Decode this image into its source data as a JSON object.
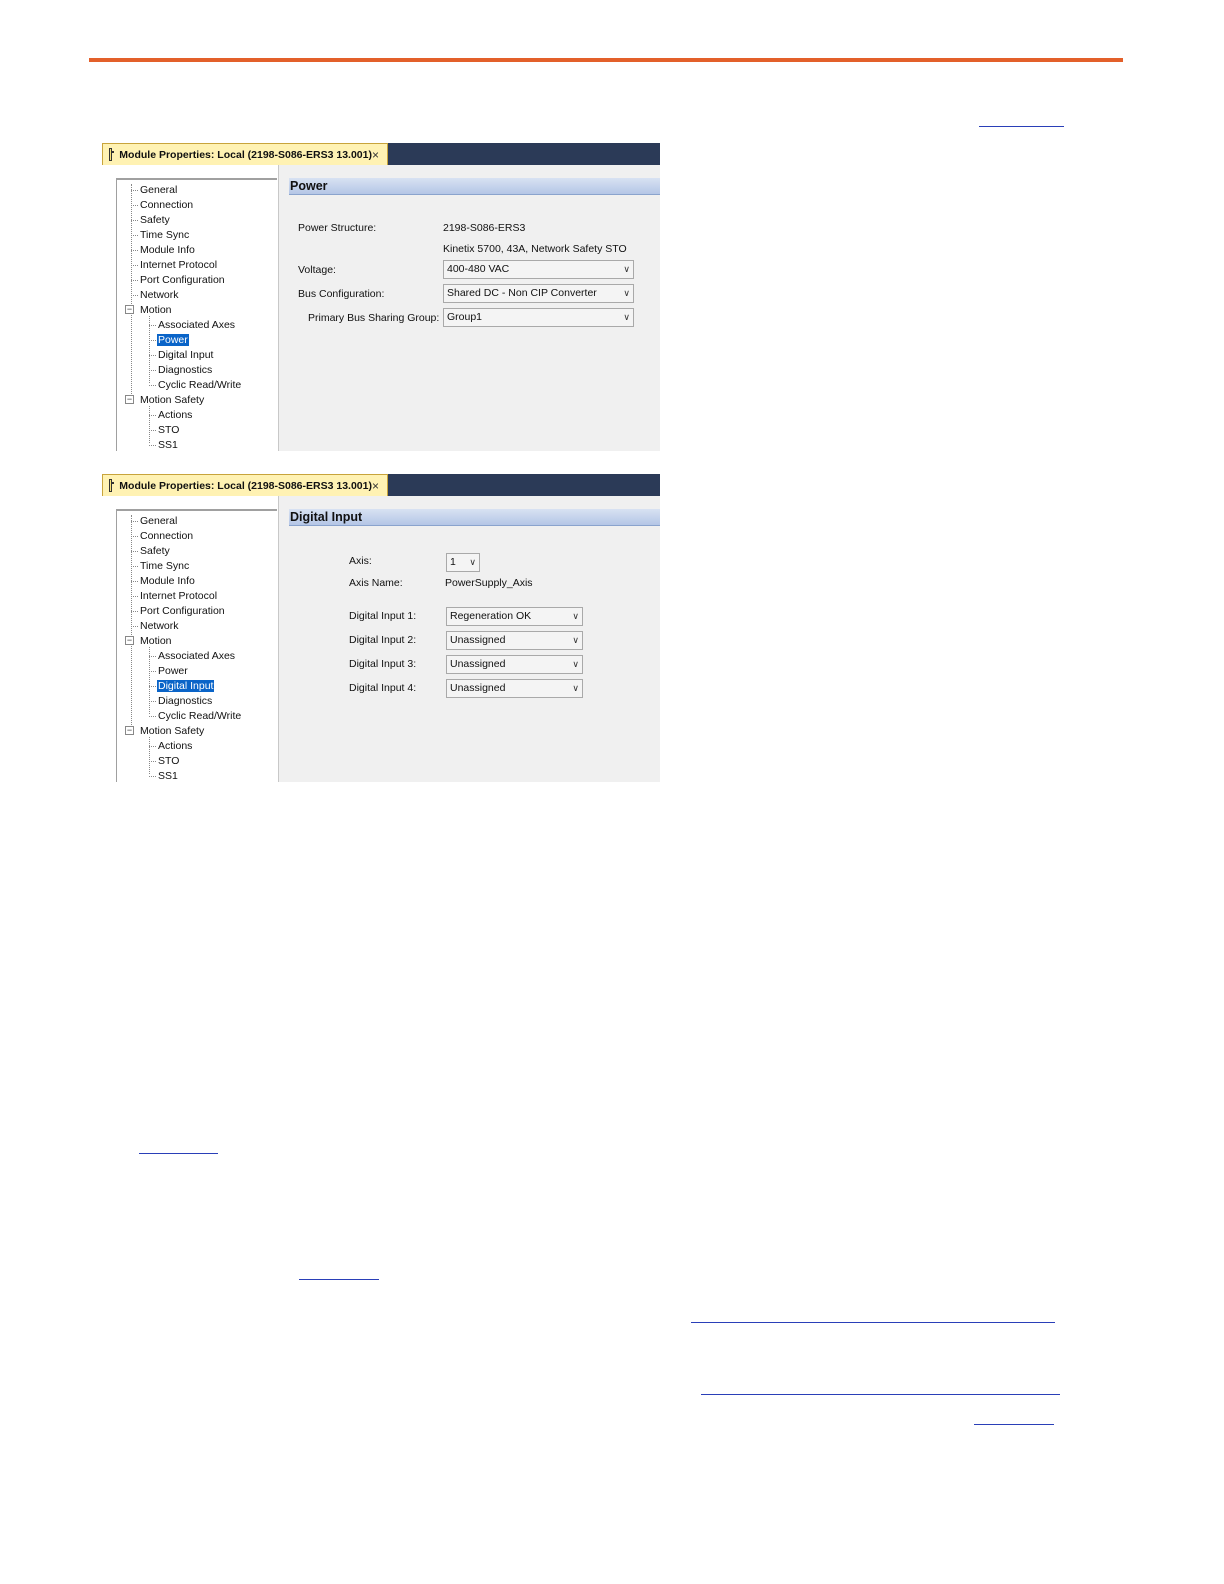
{
  "dialogs": [
    {
      "tab_title": "Module Properties: Local (2198-S086-ERS3 13.001)",
      "close_glyph": "×",
      "section": "Power",
      "selected_node": "Power",
      "tree": {
        "general": "General",
        "connection": "Connection",
        "safety": "Safety",
        "time_sync": "Time Sync",
        "module_info": "Module Info",
        "internet_protocol": "Internet Protocol",
        "port_configuration": "Port Configuration",
        "network": "Network",
        "motion": "Motion",
        "associated_axes": "Associated Axes",
        "power": "Power",
        "digital_input": "Digital Input",
        "diagnostics": "Diagnostics",
        "cyclic_read_write": "Cyclic Read/Write",
        "motion_safety": "Motion Safety",
        "actions": "Actions",
        "sto": "STO",
        "ss1": "SS1",
        "collapse_glyph": "−"
      },
      "fields": {
        "power_structure_label": "Power Structure:",
        "power_structure_value": "2198-S086-ERS3",
        "power_structure_desc": "Kinetix 5700, 43A, Network Safety STO",
        "voltage_label": "Voltage:",
        "voltage_value": "400-480 VAC",
        "bus_configuration_label": "Bus Configuration:",
        "bus_configuration_value": "Shared DC - Non CIP Converter",
        "bus_sharing_group_label": "Primary Bus Sharing Group:",
        "bus_sharing_group_value": "Group1"
      }
    },
    {
      "tab_title": "Module Properties: Local (2198-S086-ERS3 13.001)",
      "close_glyph": "×",
      "section": "Digital Input",
      "selected_node": "Digital Input",
      "tree": {
        "general": "General",
        "connection": "Connection",
        "safety": "Safety",
        "time_sync": "Time Sync",
        "module_info": "Module Info",
        "internet_protocol": "Internet Protocol",
        "port_configuration": "Port Configuration",
        "network": "Network",
        "motion": "Motion",
        "associated_axes": "Associated Axes",
        "power": "Power",
        "digital_input": "Digital Input",
        "diagnostics": "Diagnostics",
        "cyclic_read_write": "Cyclic Read/Write",
        "motion_safety": "Motion Safety",
        "actions": "Actions",
        "sto": "STO",
        "ss1": "SS1",
        "collapse_glyph": "−"
      },
      "fields": {
        "axis_label": "Axis:",
        "axis_value": "1",
        "axis_name_label": "Axis Name:",
        "axis_name_value": "PowerSupply_Axis",
        "di1_label": "Digital Input 1:",
        "di1_value": "Regeneration OK",
        "di2_label": "Digital Input 2:",
        "di2_value": "Unassigned",
        "di3_label": "Digital Input 3:",
        "di3_value": "Unassigned",
        "di4_label": "Digital Input 4:",
        "di4_value": "Unassigned"
      }
    }
  ],
  "icons": {
    "tab": "module-icon",
    "close": "close-icon",
    "dropdown": "chevron-down-icon",
    "collapse": "collapse-minus-icon"
  },
  "colors": {
    "accent_rule": "#e3602a",
    "title_bar": "#2b3a57",
    "tab_bg": "#fff2b3",
    "selection": "#0a64c8",
    "link_underline": "#2a3fb8"
  }
}
